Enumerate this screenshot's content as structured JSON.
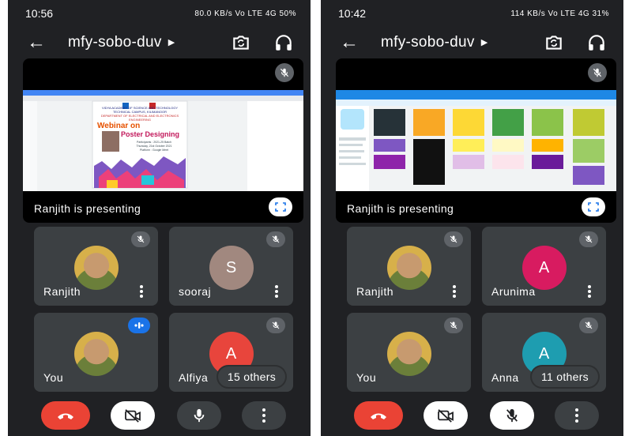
{
  "phones": [
    {
      "status": {
        "time": "10:56",
        "system": "80.0 KB/s  Vo LTE  4G  50%"
      },
      "meeting": {
        "code": "mfy-sobo-duv"
      },
      "presenting": {
        "label": "Ranjith is presenting"
      },
      "poster": {
        "org": "VIDYA ACADEMY OF SCIENCE AND TECHNOLOGY",
        "campus": "TECHNICAL CAMPUS, KILIMANOOR",
        "dept": "DEPARTMENT OF ELECTRICAL AND ELECTRONICS ENGINEERING",
        "line1": "Webinar on",
        "line2": "Poster Designing",
        "participants": "Participants : 2021-25 Batch",
        "date": "Thursday, 21st October 2021",
        "platform": "Platform : Google Meet"
      },
      "tiles": [
        {
          "name": "Ranjith",
          "initial": "",
          "color": "",
          "state": "muted"
        },
        {
          "name": "sooraj",
          "initial": "S",
          "color": "#a1887f",
          "state": "muted"
        },
        {
          "name": "You",
          "initial": "",
          "color": "",
          "state": "speaking"
        },
        {
          "name": "Alfiya",
          "initial": "A",
          "color": "#e8453c",
          "state": "muted",
          "others": "15 others"
        }
      ],
      "mic_on": true
    },
    {
      "status": {
        "time": "10:42",
        "system": "114 KB/s  Vo LTE  4G  31%"
      },
      "meeting": {
        "code": "mfy-sobo-duv"
      },
      "presenting": {
        "label": "Ranjith is presenting"
      },
      "tiles": [
        {
          "name": "Ranjith",
          "initial": "",
          "color": "",
          "state": "muted"
        },
        {
          "name": "Arunima",
          "initial": "A",
          "color": "#d81b60",
          "state": "muted"
        },
        {
          "name": "You",
          "initial": "",
          "color": "",
          "state": "muted"
        },
        {
          "name": "Anna",
          "initial": "A",
          "color": "#1e9db0",
          "state": "muted",
          "others": "11 others"
        }
      ],
      "mic_on": false
    }
  ]
}
